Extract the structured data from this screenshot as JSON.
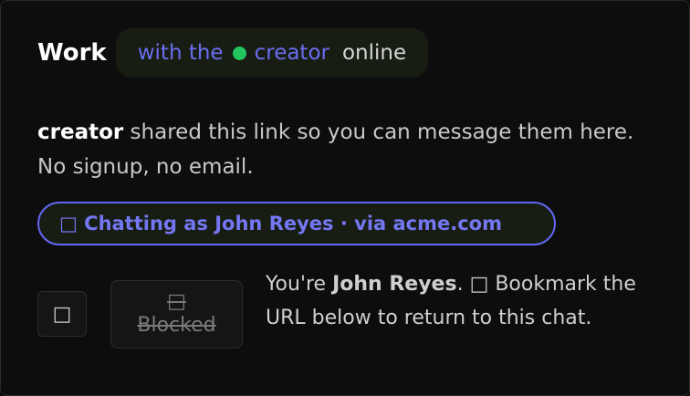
{
  "header": {
    "title": "Work",
    "pill": {
      "with_the": "with the",
      "creator": "creator",
      "status": "online",
      "status_color": "#22c55e"
    }
  },
  "description": {
    "creator": "creator",
    "text": " shared this link so you can message them here. No signup, no email."
  },
  "chat_pill": {
    "label": "□ Chatting as John Reyes · via acme.com"
  },
  "actions": {
    "square_icon": "□",
    "blocked_icon": "□",
    "blocked_label": "Blocked"
  },
  "note": {
    "prefix": "You're ",
    "name": "John Reyes",
    "suffix": ". □ Bookmark the URL below to return to this chat."
  },
  "colors": {
    "accent": "#6366f1",
    "accent_text": "#7477f2",
    "online": "#22c55e",
    "background": "#0d0d0d"
  }
}
